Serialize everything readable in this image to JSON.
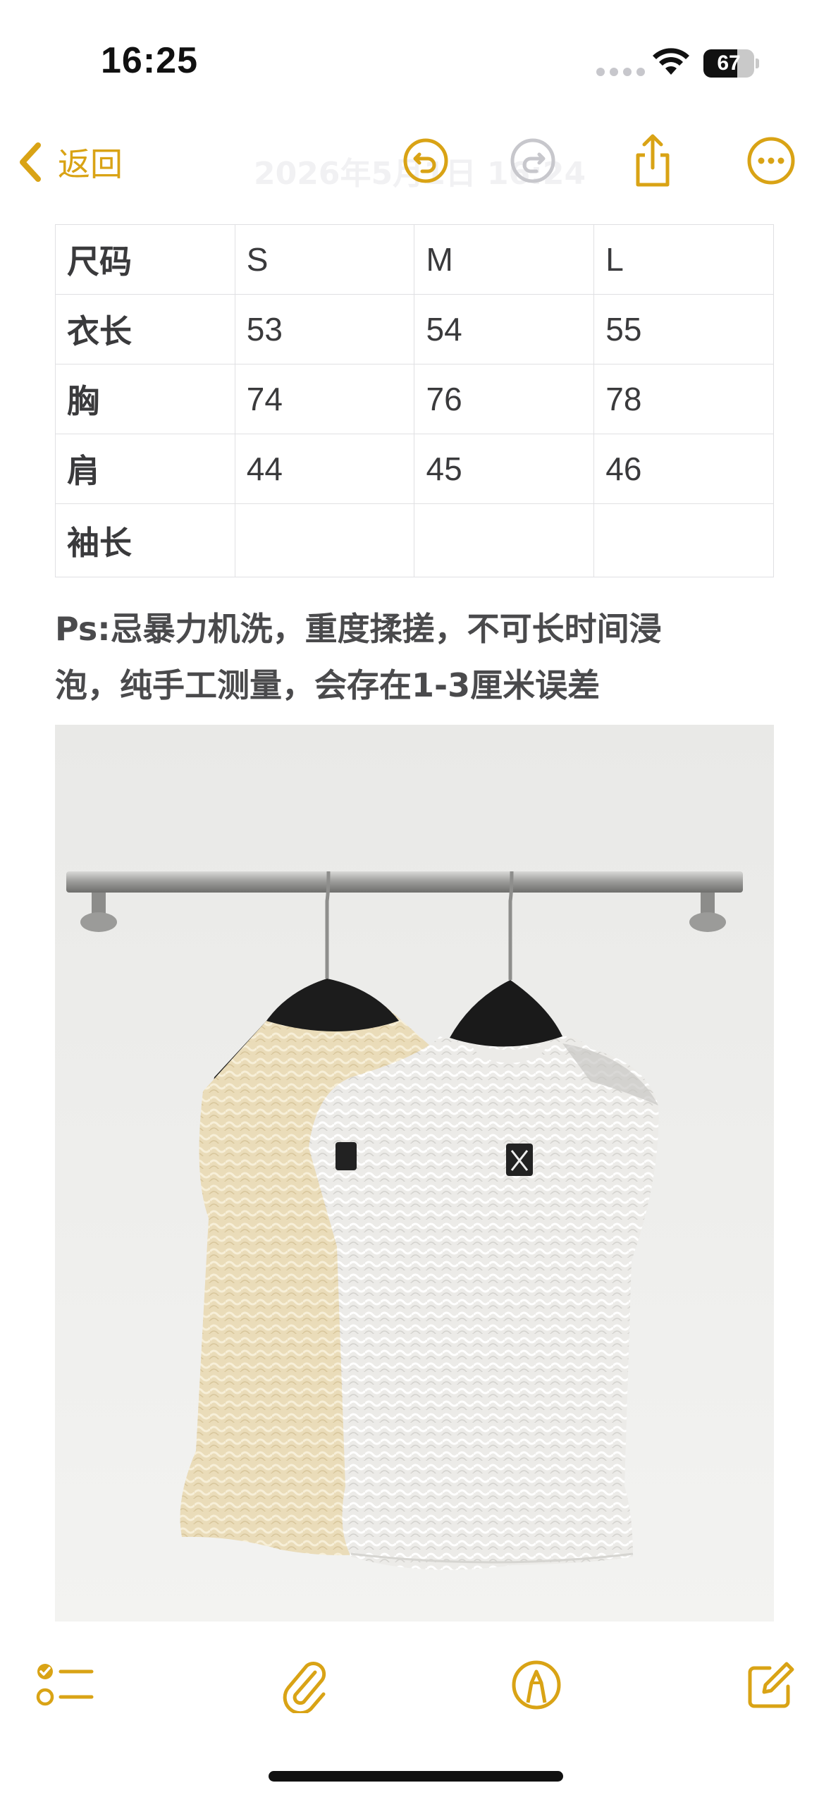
{
  "status_bar": {
    "time": "16:25",
    "battery_level": "67",
    "battery_fraction": 0.67
  },
  "nav": {
    "back_label": "返回",
    "title_faded": "2026年5月1日 16:24",
    "icons": [
      "undo-icon",
      "redo-icon",
      "share-icon",
      "more-icon"
    ]
  },
  "colors": {
    "accent": "#D9A315",
    "text": "#3A3A3C",
    "grid": "#E0E0E3"
  },
  "table": {
    "header": [
      "尺码",
      "S",
      "M",
      "L"
    ],
    "rows": [
      [
        "衣长",
        "53",
        "54",
        "55"
      ],
      [
        "胸",
        "74",
        "76",
        "78"
      ],
      [
        "肩",
        "44",
        "45",
        "46"
      ],
      [
        "袖长",
        "",
        "",
        ""
      ]
    ]
  },
  "note": {
    "line1": "Ps:忌暴力机洗，重度揉搓，不可长时间浸",
    "line2": "泡，纯手工测量，会存在1-3厘米误差"
  },
  "toolbar": {
    "icons": [
      "checklist-icon",
      "paperclip-icon",
      "markup-pen-icon",
      "compose-icon"
    ]
  }
}
